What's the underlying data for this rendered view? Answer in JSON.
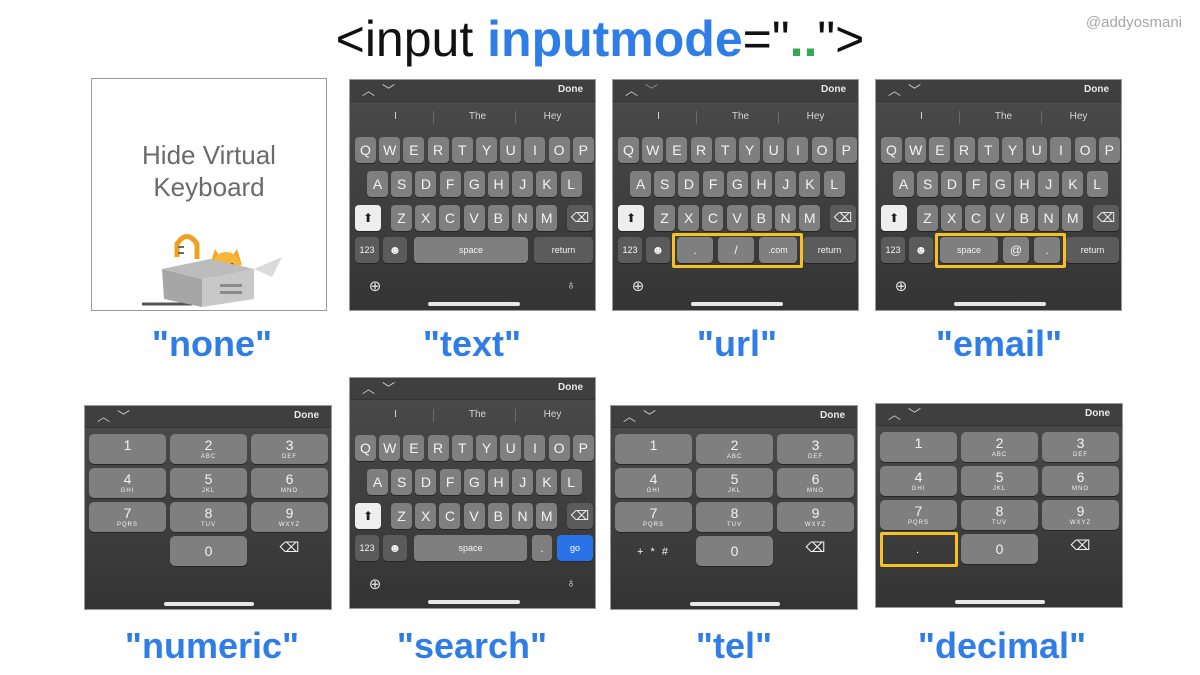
{
  "title": {
    "prefix": "<input ",
    "keyword": "inputmode",
    "equals": "=\"",
    "dots": "..",
    "suffix": "\">"
  },
  "handle": "@addyosmani",
  "none_panel": {
    "line1": "Hide Virtual",
    "line2": "Keyboard"
  },
  "captions": {
    "none": "\"none\"",
    "text": "\"text\"",
    "url": "\"url\"",
    "email": "\"email\"",
    "numeric": "\"numeric\"",
    "search": "\"search\"",
    "tel": "\"tel\"",
    "decimal": "\"decimal\""
  },
  "keyboard": {
    "done": "Done",
    "suggestions": [
      "I",
      "The",
      "Hey"
    ],
    "row1": [
      "Q",
      "W",
      "E",
      "R",
      "T",
      "Y",
      "U",
      "I",
      "O",
      "P"
    ],
    "row2": [
      "A",
      "S",
      "D",
      "F",
      "G",
      "H",
      "J",
      "K",
      "L"
    ],
    "row3": [
      "Z",
      "X",
      "C",
      "V",
      "B",
      "N",
      "M"
    ],
    "key_123": "123",
    "space": "space",
    "return": "return",
    "go": "go",
    "url_keys": [
      ".",
      "/",
      ".com"
    ],
    "email_keys": [
      "space",
      "@",
      "."
    ],
    "search_dot": "."
  },
  "numpad": {
    "keys": [
      {
        "digit": "1",
        "letters": ""
      },
      {
        "digit": "2",
        "letters": "ABC"
      },
      {
        "digit": "3",
        "letters": "DEF"
      },
      {
        "digit": "4",
        "letters": "GHI"
      },
      {
        "digit": "5",
        "letters": "JKL"
      },
      {
        "digit": "6",
        "letters": "MNO"
      },
      {
        "digit": "7",
        "letters": "PQRS"
      },
      {
        "digit": "8",
        "letters": "TUV"
      },
      {
        "digit": "9",
        "letters": "WXYZ"
      }
    ],
    "zero": "0",
    "tel_symbols": "+ * #",
    "decimal_dot": "."
  },
  "colors": {
    "accent_blue": "#2f7de6",
    "accent_green": "#34a853",
    "highlight": "#f6c026",
    "keyboard_bg": "#3b3b3b"
  },
  "icons": [
    "shift-icon",
    "backspace-icon",
    "emoji-icon",
    "globe-icon",
    "microphone-icon",
    "chevron-up-icon",
    "chevron-down-icon"
  ]
}
